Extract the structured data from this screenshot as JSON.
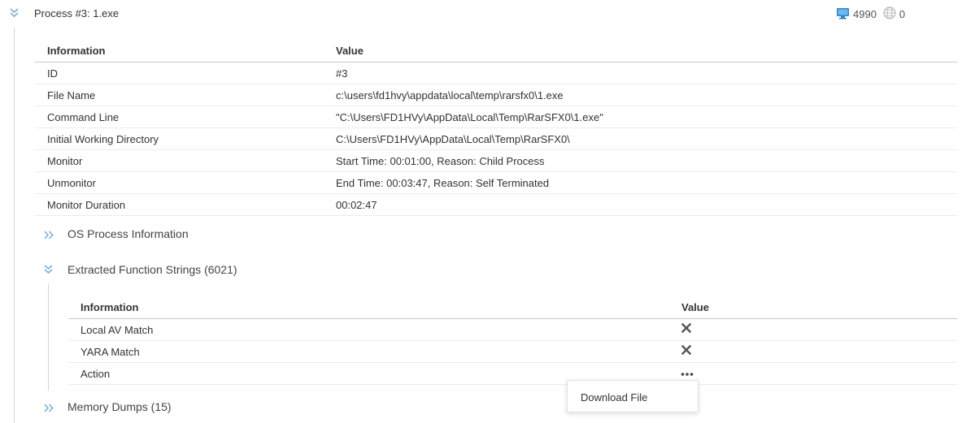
{
  "process": {
    "title": "Process #3: 1.exe",
    "stats": {
      "monitor_count": "4990",
      "network_count": "0"
    }
  },
  "info_table": {
    "headers": [
      "Information",
      "Value"
    ],
    "rows": [
      {
        "label": "ID",
        "value": "#3"
      },
      {
        "label": "File Name",
        "value": "c:\\users\\fd1hvy\\appdata\\local\\temp\\rarsfx0\\1.exe"
      },
      {
        "label": "Command Line",
        "value": "\"C:\\Users\\FD1HVy\\AppData\\Local\\Temp\\RarSFX0\\1.exe\""
      },
      {
        "label": "Initial Working Directory",
        "value": "C:\\Users\\FD1HVy\\AppData\\Local\\Temp\\RarSFX0\\"
      },
      {
        "label": "Monitor",
        "value": "Start Time: 00:01:00, Reason: Child Process"
      },
      {
        "label": "Unmonitor",
        "value": "End Time: 00:03:47, Reason: Self Terminated"
      },
      {
        "label": "Monitor Duration",
        "value": "00:02:47"
      }
    ]
  },
  "sections": {
    "os_process": "OS Process Information",
    "extracted_strings": "Extracted Function Strings (6021)",
    "memory_dumps": "Memory Dumps (15)"
  },
  "strings_table": {
    "headers": [
      "Information",
      "Value"
    ],
    "rows": [
      {
        "label": "Local AV Match",
        "value_icon": "close-x-icon"
      },
      {
        "label": "YARA Match",
        "value_icon": "close-x-icon"
      },
      {
        "label": "Action",
        "value_icon": "more-dots-icon"
      }
    ]
  },
  "popup": {
    "item": "Download File"
  },
  "colors": {
    "chevron": "#6aa6d6",
    "monitor_icon": "#2f86c8",
    "text": "#333333"
  }
}
